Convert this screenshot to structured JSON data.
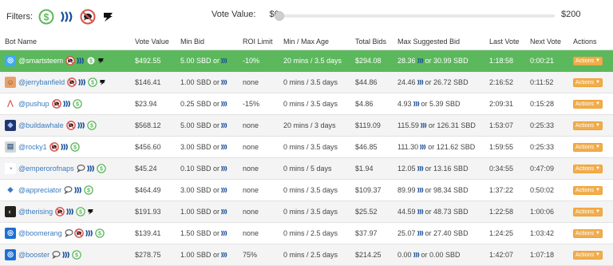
{
  "filters": {
    "label": "Filters:",
    "icons": [
      "dollar-circle-icon",
      "steem-icon",
      "no-comment-icon",
      "refund-icon"
    ]
  },
  "vote": {
    "label": "Vote Value:",
    "min": "$0",
    "max": "$200",
    "slider_fraction": 0.0
  },
  "table": {
    "headers": [
      "Bot Name",
      "Vote Value",
      "Min Bid",
      "ROI Limit",
      "Min / Max Age",
      "Total Bids",
      "Max Suggested Bid",
      "Last Vote",
      "Next Vote",
      "Actions"
    ],
    "action_label": "Actions",
    "rows": [
      {
        "name": "@smartsteem",
        "avatar": "smartsteem-avatar",
        "icons": [
          "no-comment",
          "steem",
          "dollar",
          "refund"
        ],
        "vote_value": "$492.55",
        "min_bid_amt": "5.00 SBD or",
        "roi": "-10%",
        "age": "20 mins / 3.5 days",
        "total": "$294.08",
        "sugg_a": "28.36",
        "sugg_b": "or 30.99 SBD",
        "last": "1:18:58",
        "next": "0:00:21",
        "highlight": true
      },
      {
        "name": "@jerrybanfield",
        "avatar": "jerrybanfield-avatar",
        "icons": [
          "no-comment",
          "steem",
          "dollar",
          "refund"
        ],
        "vote_value": "$146.41",
        "min_bid_amt": "1.00 SBD or",
        "roi": "none",
        "age": "0 mins / 3.5 days",
        "total": "$44.86",
        "sugg_a": "24.46",
        "sugg_b": "or 26.72 SBD",
        "last": "2:16:52",
        "next": "0:11:52",
        "highlight": false
      },
      {
        "name": "@pushup",
        "avatar": "pushup-avatar",
        "icons": [
          "no-comment",
          "steem",
          "dollar"
        ],
        "vote_value": "$23.94",
        "min_bid_amt": "0.25 SBD or",
        "roi": "-15%",
        "age": "0 mins / 3.5 days",
        "total": "$4.86",
        "sugg_a": "4.93",
        "sugg_b": "or 5.39 SBD",
        "last": "2:09:31",
        "next": "0:15:28",
        "highlight": false
      },
      {
        "name": "@buildawhale",
        "avatar": "buildawhale-avatar",
        "icons": [
          "no-comment",
          "steem",
          "dollar"
        ],
        "vote_value": "$568.12",
        "min_bid_amt": "5.00 SBD or",
        "roi": "none",
        "age": "20 mins / 3 days",
        "total": "$119.09",
        "sugg_a": "115.59",
        "sugg_b": "or 126.31 SBD",
        "last": "1:53:07",
        "next": "0:25:33",
        "highlight": false
      },
      {
        "name": "@rocky1",
        "avatar": "rocky1-avatar",
        "icons": [
          "no-comment",
          "steem",
          "dollar"
        ],
        "vote_value": "$456.60",
        "min_bid_amt": "3.00 SBD or",
        "roi": "none",
        "age": "0 mins / 3.5 days",
        "total": "$46.85",
        "sugg_a": "111.30",
        "sugg_b": "or 121.62 SBD",
        "last": "1:59:55",
        "next": "0:25:33",
        "highlight": false
      },
      {
        "name": "@emperorofnaps",
        "avatar": "emperorofnaps-avatar",
        "icons": [
          "comment",
          "steem",
          "dollar"
        ],
        "vote_value": "$45.24",
        "min_bid_amt": "0.10 SBD or",
        "roi": "none",
        "age": "0 mins / 5 days",
        "total": "$1.94",
        "sugg_a": "12.05",
        "sugg_b": "or 13.16 SBD",
        "last": "0:34:55",
        "next": "0:47:09",
        "highlight": false
      },
      {
        "name": "@appreciator",
        "avatar": "appreciator-avatar",
        "icons": [
          "comment",
          "steem",
          "dollar"
        ],
        "vote_value": "$464.49",
        "min_bid_amt": "3.00 SBD or",
        "roi": "none",
        "age": "0 mins / 3.5 days",
        "total": "$109.37",
        "sugg_a": "89.99",
        "sugg_b": "or 98.34 SBD",
        "last": "1:37:22",
        "next": "0:50:02",
        "highlight": false
      },
      {
        "name": "@therising",
        "avatar": "therising-avatar",
        "icons": [
          "no-comment",
          "steem",
          "dollar",
          "refund"
        ],
        "vote_value": "$191.93",
        "min_bid_amt": "1.00 SBD or",
        "roi": "none",
        "age": "0 mins / 3.5 days",
        "total": "$25.52",
        "sugg_a": "44.59",
        "sugg_b": "or 48.73 SBD",
        "last": "1:22:58",
        "next": "1:00:06",
        "highlight": false
      },
      {
        "name": "@boomerang",
        "avatar": "boomerang-avatar",
        "icons": [
          "comment",
          "no-comment",
          "steem",
          "dollar"
        ],
        "vote_value": "$139.41",
        "min_bid_amt": "1.50 SBD or",
        "roi": "none",
        "age": "0 mins / 2.5 days",
        "total": "$37.97",
        "sugg_a": "25.07",
        "sugg_b": "or 27.40 SBD",
        "last": "1:24:25",
        "next": "1:03:42",
        "highlight": false
      },
      {
        "name": "@booster",
        "avatar": "booster-avatar",
        "icons": [
          "comment",
          "steem",
          "dollar"
        ],
        "vote_value": "$278.75",
        "min_bid_amt": "1.00 SBD or",
        "roi": "75%",
        "age": "0 mins / 2.5 days",
        "total": "$214.25",
        "sugg_a": "0.00",
        "sugg_b": "or 0.00 SBD",
        "last": "1:42:07",
        "next": "1:07:18",
        "highlight": false
      }
    ]
  },
  "colors": {
    "highlight_row": "#5cb85c",
    "link": "#3a7bbf",
    "action_button": "#f0ad4e",
    "dollar_green": "#5cb85c",
    "no_comment_red": "#d9534f",
    "steem_blue": "#1a5099"
  }
}
